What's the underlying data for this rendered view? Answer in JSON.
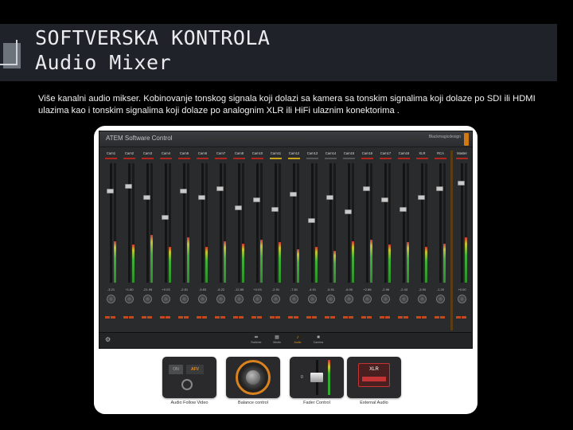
{
  "slide": {
    "title_line1": "SOFTVERSKA KONTROLA",
    "title_line2": "Audio Mixer",
    "body": "Više kanalni audio mikser. Kobinovanje tonskog signala koji dolazi sa kamera sa tonskim signalima koji dolaze po SDI ili HDMI ulazima kao i tonskim signalima koji dolaze po analognim XLR ili HiFi ulaznim konektorima ."
  },
  "app": {
    "title": "ATEM Software Control",
    "logo": "Blackmagicdesign",
    "channels": [
      {
        "label": "Cam1",
        "tally": "red",
        "level": 0.35,
        "fader": 0.78,
        "db": "-3.21"
      },
      {
        "label": "Cam2",
        "tally": "red",
        "level": 0.32,
        "fader": 0.82,
        "db": "+1.80"
      },
      {
        "label": "Cam3",
        "tally": "red",
        "level": 0.4,
        "fader": 0.72,
        "db": "-21.95"
      },
      {
        "label": "Cam4",
        "tally": "red",
        "level": 0.3,
        "fader": 0.55,
        "db": "+0.03"
      },
      {
        "label": "Cam5",
        "tally": "red",
        "level": 0.38,
        "fader": 0.78,
        "db": "-2.81"
      },
      {
        "label": "Cam6",
        "tally": "red",
        "level": 0.3,
        "fader": 0.72,
        "db": "-3.83"
      },
      {
        "label": "Cam7",
        "tally": "red",
        "level": 0.35,
        "fader": 0.8,
        "db": "-6.22"
      },
      {
        "label": "Cam8",
        "tally": "red",
        "level": 0.33,
        "fader": 0.63,
        "db": "-12.85"
      },
      {
        "label": "Cam10",
        "tally": "red",
        "level": 0.36,
        "fader": 0.7,
        "db": "+0.03"
      },
      {
        "label": "Cam11",
        "tally": "yellow",
        "level": 0.34,
        "fader": 0.62,
        "db": "-2.91"
      },
      {
        "label": "Cam12",
        "tally": "yellow",
        "level": 0.28,
        "fader": 0.75,
        "db": "-7.81"
      },
      {
        "label": "Cam13",
        "tally": "off",
        "level": 0.3,
        "fader": 0.52,
        "db": "-4.91"
      },
      {
        "label": "Cam14",
        "tally": "off",
        "level": 0.27,
        "fader": 0.72,
        "db": "-5.91"
      },
      {
        "label": "Cam15",
        "tally": "off",
        "level": 0.35,
        "fader": 0.6,
        "db": "-6.00"
      },
      {
        "label": "Cam16",
        "tally": "red",
        "level": 0.36,
        "fader": 0.8,
        "db": "+2.86"
      },
      {
        "label": "Cam17",
        "tally": "red",
        "level": 0.32,
        "fader": 0.7,
        "db": "-2.96"
      },
      {
        "label": "Cam18",
        "tally": "red",
        "level": 0.34,
        "fader": 0.62,
        "db": "-2.43"
      },
      {
        "label": "XLR",
        "tally": "red",
        "level": 0.3,
        "fader": 0.72,
        "db": "-3.90"
      },
      {
        "label": "RCA",
        "tally": "red",
        "level": 0.33,
        "fader": 0.8,
        "db": "-1.20"
      },
      {
        "label": "Master",
        "tally": "red",
        "level": 0.38,
        "fader": 0.85,
        "db": "+0.00"
      }
    ],
    "nav_tabs": [
      {
        "label": "Switcher",
        "icon": "switcher-icon",
        "active": false
      },
      {
        "label": "Media",
        "icon": "media-icon",
        "active": false
      },
      {
        "label": "Audio",
        "icon": "audio-icon",
        "active": true
      },
      {
        "label": "Camera",
        "icon": "camera-icon",
        "active": false
      }
    ]
  },
  "features": {
    "afv_caption": "Audio Follow Video",
    "afv_on": "ON",
    "afv_label": "AFV",
    "balance_caption": "Balance control",
    "fader_caption": "Fader Control",
    "fader_zero": "0",
    "external_caption": "External Audio",
    "external_label": "XLR"
  },
  "colors": {
    "accent_orange": "#e5962b",
    "tally_red": "#b3261e",
    "tally_yellow": "#c9a21b"
  }
}
